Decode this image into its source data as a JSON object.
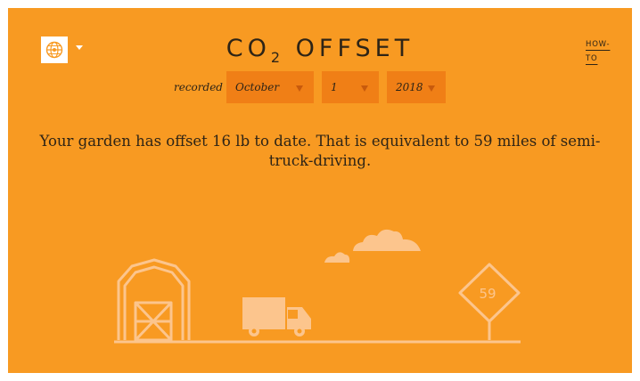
{
  "header": {
    "title_prefix": "CO",
    "title_subscript": "2",
    "title_suffix": "OFFSET",
    "howto_line1": "HOW-",
    "howto_line2": "TO"
  },
  "logo": {
    "icon": "globe-icon"
  },
  "recorded": {
    "label": "recorded",
    "month": "October",
    "day": "1",
    "year": "2018"
  },
  "summary": {
    "sentence": "Your garden has offset 16 lb to date. That is equivalent to 59 miles of semi-truck-driving."
  },
  "illustration": {
    "sign_value": "59",
    "icons": [
      "barn-icon",
      "truck-icon",
      "cloud-icon",
      "road-sign-icon"
    ]
  },
  "colors": {
    "background": "#f89a22",
    "select_background": "#f07f16",
    "illustration": "#fcc58d",
    "text": "#2e2416"
  }
}
